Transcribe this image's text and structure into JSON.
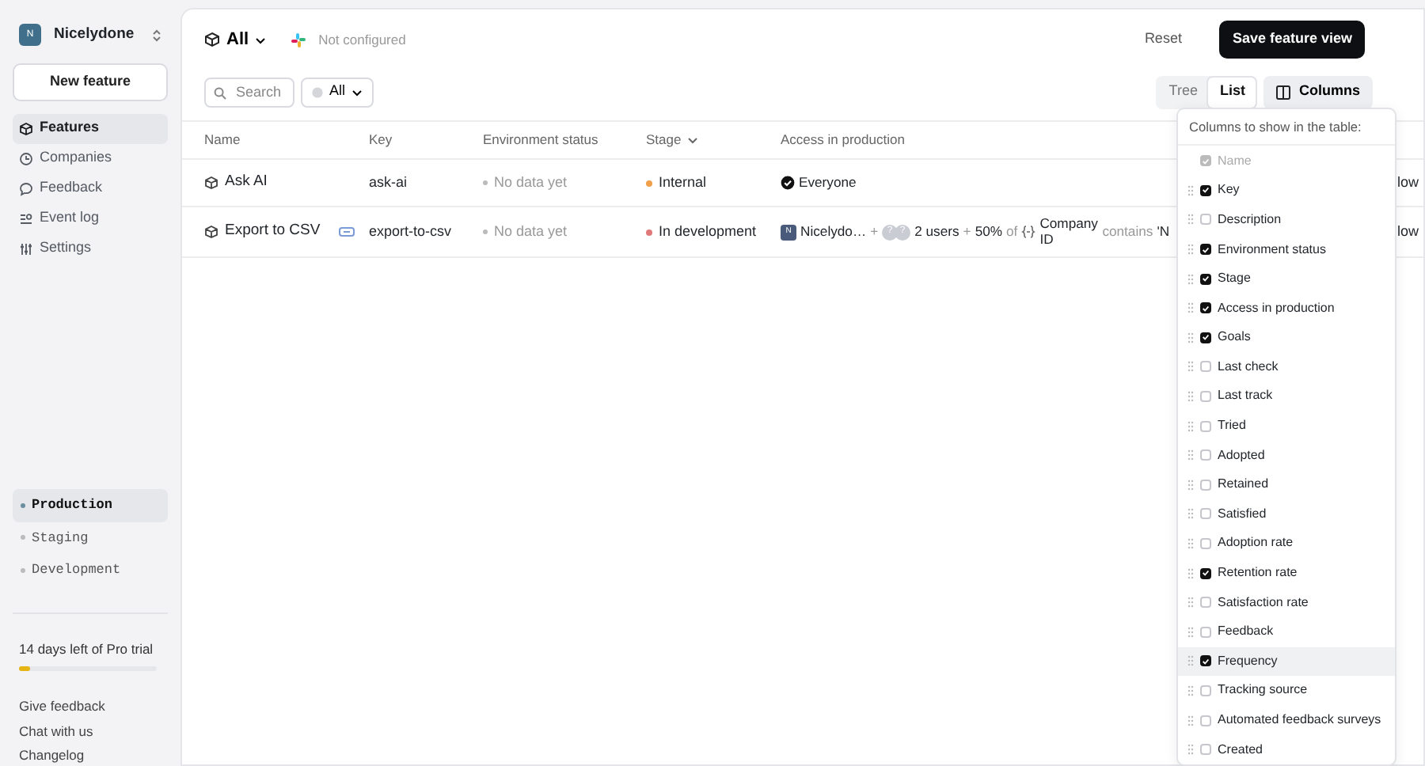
{
  "sidebar": {
    "org": {
      "initial": "N",
      "name": "Nicelydone"
    },
    "new_feature_button": "New feature",
    "nav": [
      {
        "label": "Features",
        "selected": true
      },
      {
        "label": "Companies",
        "selected": false
      },
      {
        "label": "Feedback",
        "selected": false
      },
      {
        "label": "Event log",
        "selected": false
      },
      {
        "label": "Settings",
        "selected": false
      }
    ],
    "environments": [
      {
        "label": "Production",
        "selected": true
      },
      {
        "label": "Staging",
        "selected": false
      },
      {
        "label": "Development",
        "selected": false
      }
    ],
    "trial": {
      "text": "14 days left of Pro trial",
      "level": 0.08
    },
    "links": [
      "Give feedback",
      "Chat with us",
      "Changelog"
    ]
  },
  "header": {
    "view": "All",
    "integration": "Not configured",
    "reset": "Reset",
    "save": "Save feature view"
  },
  "toolbar": {
    "search_placeholder": "Search",
    "filter": "All",
    "view_modes": [
      {
        "label": "Tree",
        "selected": false
      },
      {
        "label": "List",
        "selected": true
      }
    ],
    "columns_button": "Columns"
  },
  "table": {
    "columns": [
      {
        "label": "Name",
        "sorted": false
      },
      {
        "label": "Key",
        "sorted": false
      },
      {
        "label": "Environment status",
        "sorted": false
      },
      {
        "label": "Stage",
        "sorted": true
      },
      {
        "label": "Access in production",
        "sorted": false
      }
    ],
    "rows": [
      {
        "name": "Ask AI",
        "badge": false,
        "key": "ask-ai",
        "env_status": "No data yet",
        "stage": {
          "label": "Internal",
          "color": "#f0a04b"
        },
        "access": {
          "kind": "everyone",
          "label": "Everyone"
        },
        "column_6": "low"
      },
      {
        "name": "Export to CSV",
        "badge": true,
        "key": "export-to-csv",
        "env_status": "No data yet",
        "stage": {
          "label": "In development",
          "color": "#e07a7a"
        },
        "access": {
          "kind": "segments",
          "company_initial": "N",
          "company": "Nicelydo…",
          "plus_1": "+",
          "user_avatars": [
            "?",
            "?"
          ],
          "users": "2 users",
          "plus_2": "+",
          "percent": "50%",
          "of": "of",
          "attribute": "Company ID",
          "operator": "contains",
          "value": "'N"
        },
        "column_6": "low"
      }
    ]
  },
  "columns_menu": {
    "title": "Columns to show in the table:",
    "items": [
      {
        "label": "Name",
        "checked": true,
        "disabled": true,
        "selected": false
      },
      {
        "label": "Key",
        "checked": true,
        "disabled": false,
        "selected": false
      },
      {
        "label": "Description",
        "checked": false,
        "disabled": false,
        "selected": false
      },
      {
        "label": "Environment status",
        "checked": true,
        "disabled": false,
        "selected": false
      },
      {
        "label": "Stage",
        "checked": true,
        "disabled": false,
        "selected": false
      },
      {
        "label": "Access in production",
        "checked": true,
        "disabled": false,
        "selected": false
      },
      {
        "label": "Goals",
        "checked": true,
        "disabled": false,
        "selected": false
      },
      {
        "label": "Last check",
        "checked": false,
        "disabled": false,
        "selected": false
      },
      {
        "label": "Last track",
        "checked": false,
        "disabled": false,
        "selected": false
      },
      {
        "label": "Tried",
        "checked": false,
        "disabled": false,
        "selected": false
      },
      {
        "label": "Adopted",
        "checked": false,
        "disabled": false,
        "selected": false
      },
      {
        "label": "Retained",
        "checked": false,
        "disabled": false,
        "selected": false
      },
      {
        "label": "Satisfied",
        "checked": false,
        "disabled": false,
        "selected": false
      },
      {
        "label": "Adoption rate",
        "checked": false,
        "disabled": false,
        "selected": false
      },
      {
        "label": "Retention rate",
        "checked": true,
        "disabled": false,
        "selected": false
      },
      {
        "label": "Satisfaction rate",
        "checked": false,
        "disabled": false,
        "selected": false
      },
      {
        "label": "Feedback",
        "checked": false,
        "disabled": false,
        "selected": false
      },
      {
        "label": "Frequency",
        "checked": true,
        "disabled": false,
        "selected": true
      },
      {
        "label": "Tracking source",
        "checked": false,
        "disabled": false,
        "selected": false
      },
      {
        "label": "Automated feedback surveys",
        "checked": false,
        "disabled": false,
        "selected": false
      },
      {
        "label": "Created",
        "checked": false,
        "disabled": false,
        "selected": false
      }
    ]
  }
}
